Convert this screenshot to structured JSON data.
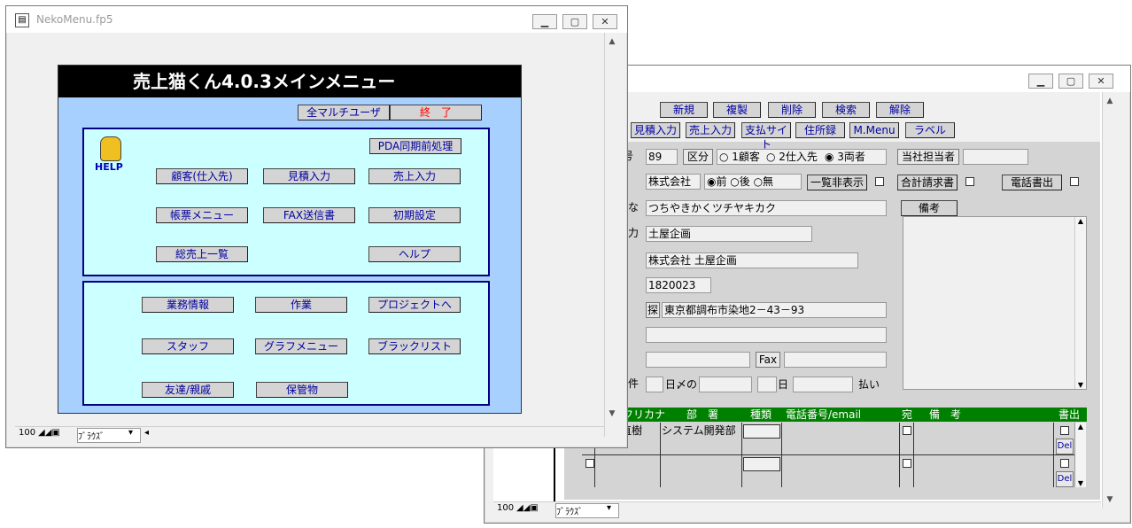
{
  "back_window": {
    "buttons_row1": [
      "新規",
      "複製",
      "削除",
      "検索",
      "解除"
    ],
    "buttons_row2": [
      "見積入力",
      "売上入力",
      "支払サイト",
      "住所録",
      "M.Menu",
      "ラベル"
    ],
    "label_left1": "号",
    "customer_no": "89",
    "kubun_label": "区分",
    "radio_kubun": [
      "○ 1顧客",
      "○ 2仕入先",
      "◉ 3両者"
    ],
    "tanto_label": "当社担当者",
    "tanto_value": "",
    "corp_type": "株式会社",
    "radio_pos": "◉前 ○後 ○無",
    "ichiran_btn": "一覧非表示",
    "gokei_btn": "合計請求書",
    "denwa_btn": "電話書出",
    "label_kana": "な",
    "kana_value": "つちやきかくツチヤキカク",
    "biko_btn": "備考",
    "label_name": "力",
    "name_value": "土屋企画",
    "full_name": "株式会社 土屋企画",
    "zip": "1820023",
    "search_icon_text": "探",
    "address": "東京都調布市染地2－43－93",
    "fax_label": "Fax",
    "pay_label_a": "日〆の",
    "pay_label_b": "日",
    "pay_label_c": "払い",
    "label_ken": "件",
    "table_headers": [
      "フリカナ",
      "部　署",
      "種類",
      "電話番号/email",
      "宛",
      "備　考",
      "書出"
    ],
    "row1_name": "直樹",
    "row1_dept": "システム開発部",
    "del_label": "Del",
    "status_zoom": "100",
    "status_mode": "ﾌﾞﾗｳｽﾞ"
  },
  "front_window": {
    "title": "NekoMenu.fp5",
    "menu_title": "売上猫くん4.0.3メインメニュー",
    "all_multi_user": "全マルチユーザ",
    "quit": "終　了",
    "help_icon_label": "HELP",
    "pda_button": "PDA同期前処理",
    "panel1": [
      "顧客(仕入先)",
      "見積入力",
      "売上入力",
      "帳票メニュー",
      "FAX送信書",
      "初期設定",
      "総売上一覧",
      "ヘルプ"
    ],
    "panel2": [
      "業務情報",
      "作業",
      "プロジェクトへ",
      "スタッフ",
      "グラフメニュー",
      "ブラックリスト",
      "友達/親戚",
      "保管物"
    ],
    "status_zoom": "100",
    "status_mode": "ﾌﾞﾗｳｽﾞ"
  },
  "colors": {
    "panel_bg": "#a8d0ff",
    "inner_bg": "#ccffff",
    "header_bg": "#000000",
    "grid_header": "#008000",
    "button_text": "#0000a0",
    "quit_text": "#ff0000"
  }
}
